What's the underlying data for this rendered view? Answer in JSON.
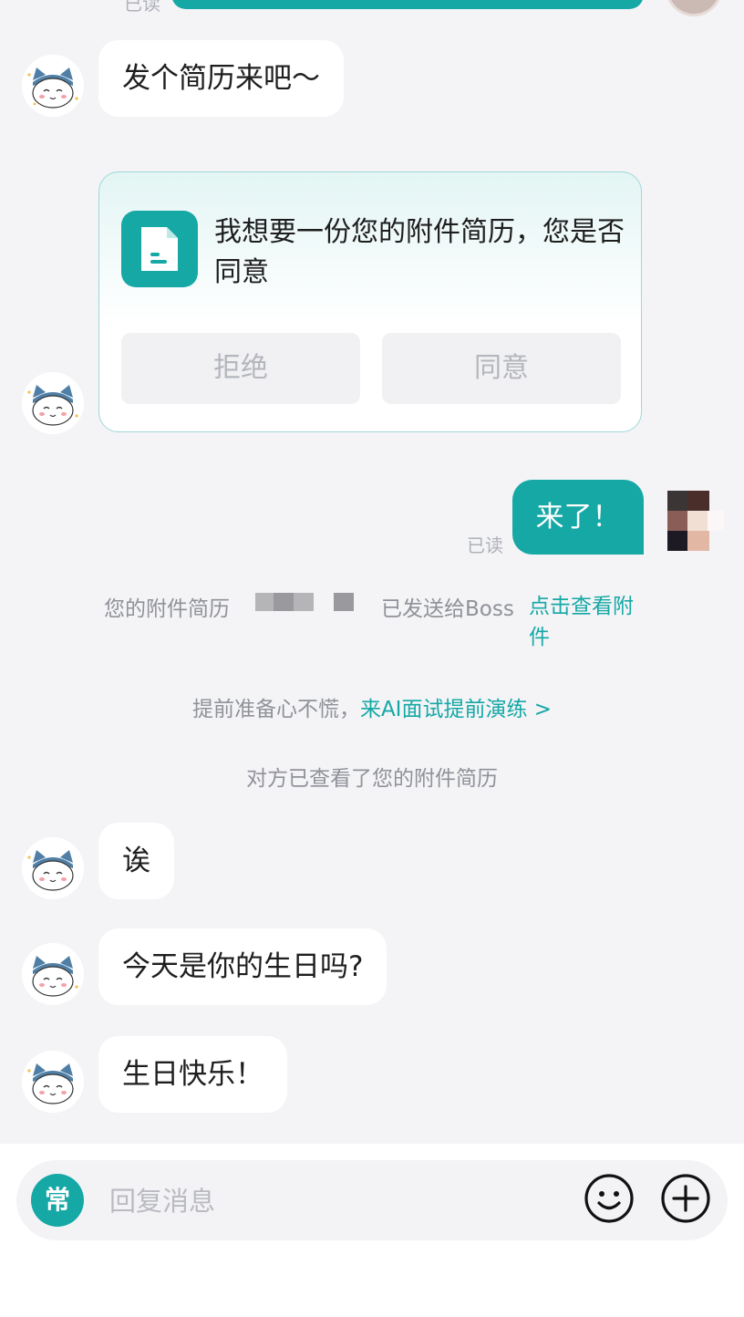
{
  "top": {
    "read_label": "已读"
  },
  "messages": {
    "m1": "发个简历来吧～",
    "card": {
      "text": "我想要一份您的附件简历，您是否同意",
      "reject_label": "拒绝",
      "accept_label": "同意"
    },
    "mine": {
      "text": "来了！",
      "read_label": "已读"
    },
    "m2": "诶",
    "m3": "今天是你的生日吗?",
    "m4": "生日快乐！"
  },
  "system": {
    "resume_prefix": "您的附件简历",
    "resume_mid": "已发送给Boss",
    "resume_link": "点击查看附件",
    "ai_prefix": "提前准备心不慌，",
    "ai_link": "来AI面试提前演练 >",
    "viewed": "对方已查看了您的附件简历"
  },
  "input": {
    "common_label": "常",
    "placeholder": "回复消息"
  },
  "colors": {
    "accent": "#15a8a5",
    "background": "#f4f4f7"
  },
  "icons": [
    "cat-avatar-icon",
    "document-icon",
    "emoji-icon",
    "plus-icon"
  ]
}
